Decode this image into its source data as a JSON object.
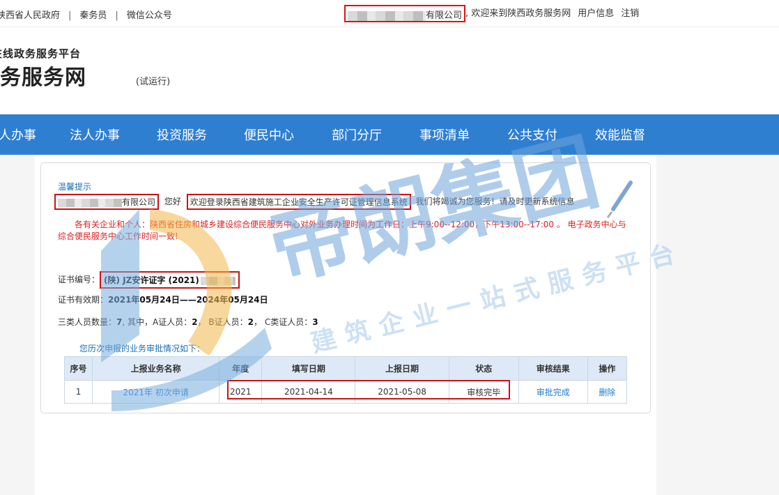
{
  "topbar": {
    "links": [
      "陕西省人民政府",
      "秦务员",
      "微信公众号"
    ],
    "separator": "|",
    "company_suffix": "有限公司",
    "welcome": ", 欢迎来到陕西政务服务网",
    "user_info": "用户信息",
    "logout": "注销"
  },
  "header": {
    "subtitle": "在线政务服务平台",
    "title": "务服务网",
    "trial": "(试运行)"
  },
  "nav": {
    "items": [
      "人办事",
      "法人办事",
      "投资服务",
      "便民中心",
      "部门分厅",
      "事项清单",
      "公共支付",
      "效能监督"
    ]
  },
  "panel": {
    "tip_title": "温馨提示",
    "company_suffix": "有限公司",
    "hello": "您好",
    "welcome_system": "欢迎登录陕西省建筑施工企业安全生产许可证管理信息系统",
    "service_msg": "我们将竭诚为您服务！请及时更新系统信息",
    "notice": "各有关企业和个人：陕西省住房和城乡建设综合便民服务中心对外业务办理时间为工作日：上午9:00--12:00，下午13:00--17:00 。 电子政务中心与综合便民服务中心工作时间一致!",
    "cert_no_label": "证书编号：",
    "cert_no_value": "(陕) JZ安许证字 (2021)",
    "validity_label": "证书有效期：",
    "validity_value": "2021年05月24日——2024年05月24日",
    "staff_label": "三类人员数量：",
    "staff_total": "7",
    "staff_among": ", 其中，A证人员：",
    "staff_a": "2",
    "staff_b_label": "， B证人员：",
    "staff_b": "2",
    "staff_c_label": "， C类证人员：",
    "staff_c": "3",
    "history_title": "您历次申报的业务审批情况如下："
  },
  "table": {
    "headers": [
      "序号",
      "上报业务名称",
      "年度",
      "填写日期",
      "上报日期",
      "状态",
      "审核结果",
      "操作"
    ],
    "rows": [
      {
        "no": "1",
        "name": "2021年 初次申请",
        "year": "2021",
        "fill_date": "2021-04-14",
        "report_date": "2021-05-08",
        "status": "审核完毕",
        "result": "审批完成",
        "action": "删除"
      }
    ]
  },
  "watermark": {
    "main": "帝朗集团",
    "sub": "建筑企业一站式服务平台"
  },
  "colors": {
    "nav_bg": "#2f7fd1",
    "tip_blue": "#1e6fb3",
    "notice_red": "#dd2222",
    "highlight_box": "#cc1111",
    "table_header_bg": "#dde9f6"
  }
}
